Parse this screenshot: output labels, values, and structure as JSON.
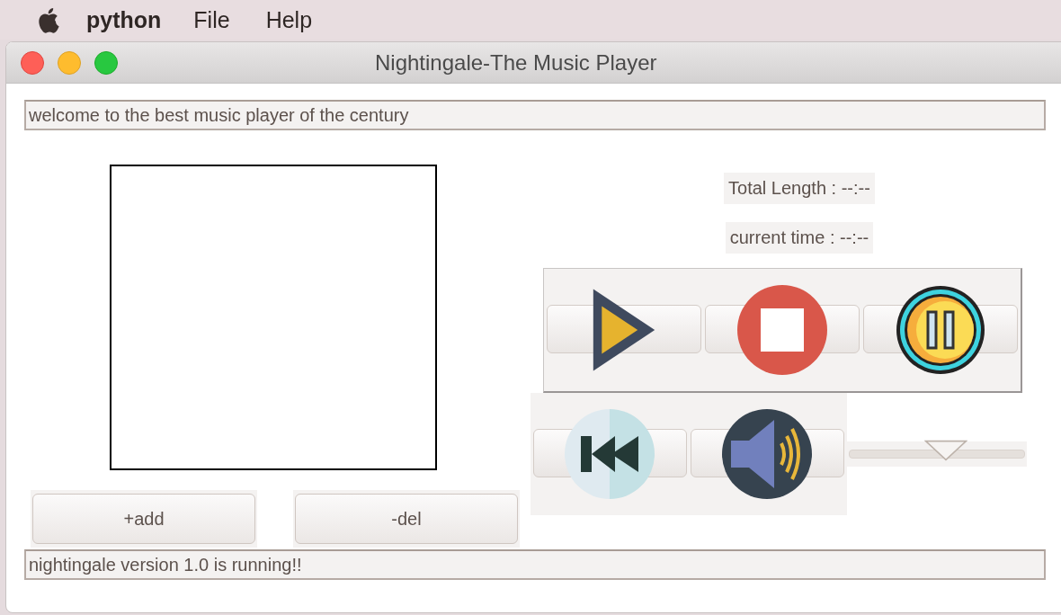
{
  "menu_bar": {
    "app_name": "python",
    "items": [
      "File",
      "Help"
    ]
  },
  "window": {
    "title": "Nightingale-The Music Player"
  },
  "welcome_field": {
    "value": "welcome to the best music player of the century"
  },
  "info": {
    "total_length": "Total Length : --:--",
    "current_time": "current time : --:--"
  },
  "playlist_buttons": [
    "+add",
    "-del"
  ],
  "volume_slider": {
    "level": 0.55
  },
  "status_bar": {
    "value": "nightingale version 1.0 is running!!"
  }
}
